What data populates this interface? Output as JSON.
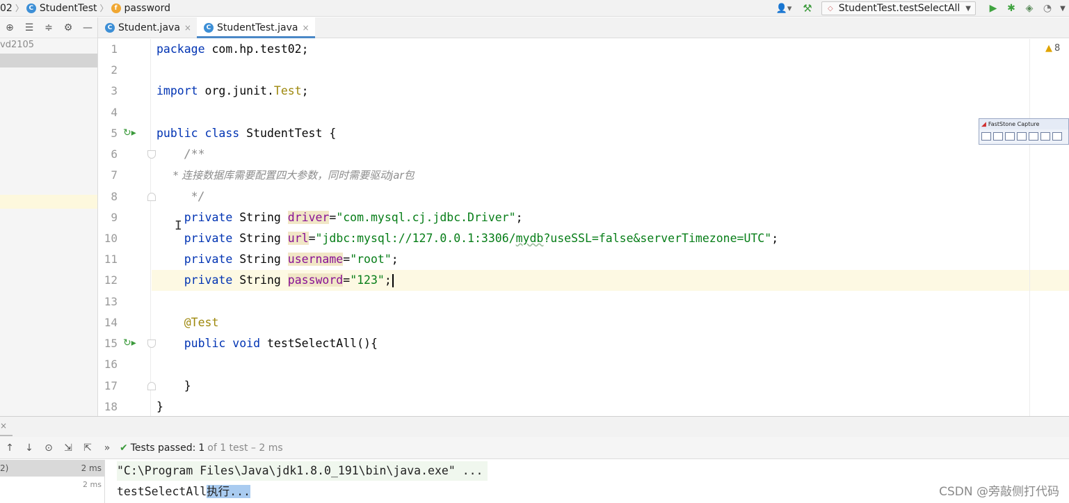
{
  "breadcrumb": {
    "items": [
      {
        "label": "02",
        "icon": ""
      },
      {
        "label": "StudentTest",
        "icon": "class-icon"
      },
      {
        "label": "password",
        "icon": "field-icon"
      }
    ]
  },
  "toolbar": {
    "run_config": "StudentTest.testSelectAll",
    "icons": [
      "user-icon",
      "hammer-icon",
      "run-icon",
      "debug-icon",
      "coverage-icon",
      "profile-icon"
    ]
  },
  "project": {
    "item": "vd2105"
  },
  "tabs": [
    {
      "label": "Student.java",
      "icon": "C",
      "close": "×"
    },
    {
      "label": "StudentTest.java",
      "icon": "C",
      "close": "×"
    }
  ],
  "editor": {
    "warning_count": "8",
    "line_numbers": [
      "1",
      "2",
      "3",
      "4",
      "5",
      "6",
      "7",
      "8",
      "9",
      "10",
      "11",
      "12",
      "13",
      "14",
      "15",
      "16",
      "17",
      "18"
    ],
    "lines": {
      "l1_kw": "package",
      "l1_rest": " com.hp.test02;",
      "l3_kw": "import",
      "l3_pkg": " org.junit.",
      "l3_cls": "Test",
      "l3_end": ";",
      "l5_kw": "public class",
      "l5_rest": " StudentTest {",
      "l6": "    /**",
      "l7": "     * 连接数据库需要配置四大参数，同时需要驱动jar包",
      "l8": "     */",
      "l9_kw": "    private",
      "l9_type": " String ",
      "l9_field": "driver",
      "l9_eq": "=",
      "l9_str": "\"com.mysql.cj.jdbc.Driver\"",
      "l9_end": ";",
      "l10_kw": "    private",
      "l10_type": " String ",
      "l10_field": "url",
      "l10_eq": "=",
      "l10_str_a": "\"jdbc:mysql://127.0.0.1:3306/",
      "l10_str_b": "mydb",
      "l10_str_c": "?useSSL=false&serverTimezone=UTC\"",
      "l10_end": ";",
      "l11_kw": "    private",
      "l11_type": " String ",
      "l11_field": "username",
      "l11_eq": "=",
      "l11_str": "\"root\"",
      "l11_end": ";",
      "l12_kw": "    private",
      "l12_type": " String ",
      "l12_field": "password",
      "l12_eq": "=",
      "l12_str": "\"123\"",
      "l12_end": ";",
      "l14": "    @Test",
      "l15_kw": "    public void",
      "l15_rest": " testSelectAll(){",
      "l17": "    }",
      "l18": "}"
    }
  },
  "faststone": {
    "title": "FastStone Capture"
  },
  "run_panel": {
    "status_prefix": "Tests passed:",
    "status_count": "1",
    "status_suffix": "of 1 test – 2 ms",
    "tree": [
      {
        "label": "2)",
        "duration": "2 ms"
      },
      {
        "label": "",
        "duration": "2 ms"
      }
    ],
    "console": {
      "line1": "\"C:\\Program Files\\Java\\jdk1.8.0_191\\bin\\java.exe\" ...",
      "line2_plain": "testSelectAll",
      "line2_selected": "执行..."
    }
  },
  "watermark": "CSDN @旁敲侧打代码"
}
